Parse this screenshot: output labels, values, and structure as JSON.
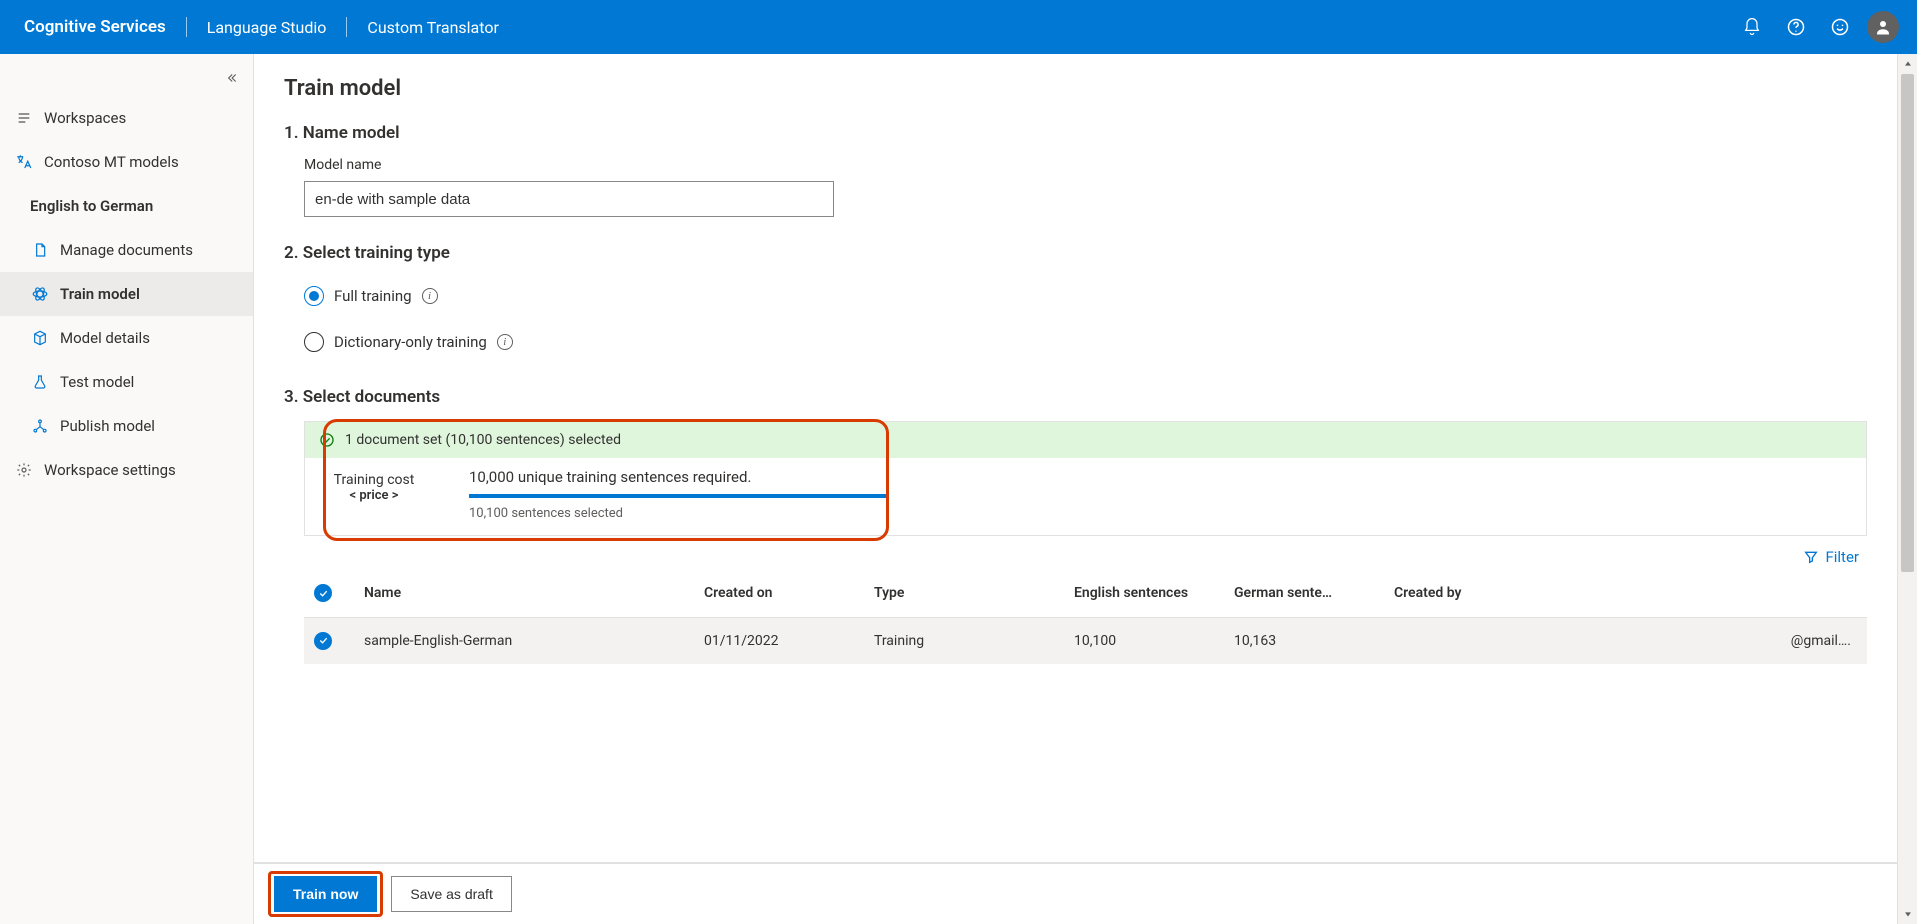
{
  "header": {
    "crumb1": "Cognitive Services",
    "crumb2": "Language Studio",
    "crumb3": "Custom Translator"
  },
  "sidebar": {
    "workspaces": "Workspaces",
    "workspace_name": "Contoso MT models",
    "project_name": "English to German",
    "items": [
      {
        "label": "Manage documents"
      },
      {
        "label": "Train model"
      },
      {
        "label": "Model details"
      },
      {
        "label": "Test model"
      },
      {
        "label": "Publish model"
      }
    ],
    "settings": "Workspace settings"
  },
  "page": {
    "title": "Train model",
    "step1_title": "1. Name model",
    "model_name_label": "Model name",
    "model_name_value": "en-de with sample data",
    "step2_title": "2. Select training type",
    "radio_full": "Full training",
    "radio_dict": "Dictionary-only training",
    "step3_title": "3. Select documents",
    "summary_top": "1 document set (10,100 sentences) selected",
    "training_cost_label": "Training cost",
    "training_cost_value": "< price >",
    "required_line": "10,000 unique training sentences required.",
    "selected_line": "10,100 sentences selected",
    "filter_label": "Filter"
  },
  "table": {
    "headers": {
      "name": "Name",
      "created": "Created on",
      "type": "Type",
      "eng": "English sentences",
      "ger": "German sente…",
      "by": "Created by"
    },
    "rows": [
      {
        "checked": true,
        "name": "sample-English-German",
        "created": "01/11/2022",
        "type": "Training",
        "eng": "10,100",
        "ger": "10,163",
        "by": "@gmail…."
      }
    ]
  },
  "footer": {
    "train": "Train now",
    "save": "Save as draft"
  }
}
